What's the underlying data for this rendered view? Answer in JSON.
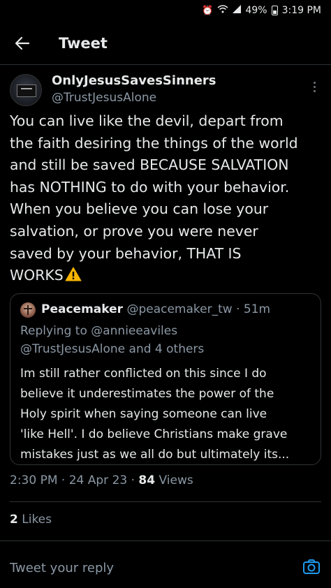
{
  "status_bar": {
    "battery": "49%",
    "time": "3:19 PM"
  },
  "header": {
    "title": "Tweet"
  },
  "tweet": {
    "display_name": "OnlyJesusSavesSinners",
    "handle": "@TrustJesusAlone",
    "text_lines": [
      "You can live like the devil, depart from",
      "the faith desiring the things of the world",
      "and still be saved BECAUSE SALVATION",
      "has NOTHING to do with your behavior.",
      "When you believe you can lose your",
      "salvation, or prove you were never",
      "saved by your behavior, THAT IS",
      "WORKS"
    ],
    "timestamp": "2:30 PM",
    "date": "24 Apr 23",
    "views_count": "84",
    "views_label": "Views",
    "likes_count": "2",
    "likes_label": "Likes"
  },
  "quoted_tweet": {
    "name": "Peacemaker",
    "handle": "@peacemaker_tw",
    "age": "51m",
    "replying_line1": "Replying to @annieeaviles",
    "replying_line2": "@TrustJesusAlone and 4 others",
    "text_lines": [
      "Im still rather conflicted on this since I do",
      "believe it underestimates the power of the",
      "Holy spirit when saying someone can live",
      "'like Hell'. I do believe Christians make grave",
      "mistakes just as we all do but ultimately its..."
    ]
  },
  "reply": {
    "placeholder": "Tweet your reply"
  },
  "colors": {
    "background": "#000000",
    "text": "#e7e9ea",
    "muted": "#8b98a5",
    "accent": "#1d9bf0",
    "divider": "#2f3336",
    "warning": "#f5b400"
  },
  "icons": {
    "back": "arrow-left-icon",
    "more": "more-vertical-icon",
    "warning": "warning-sign-icon",
    "camera": "camera-icon"
  }
}
